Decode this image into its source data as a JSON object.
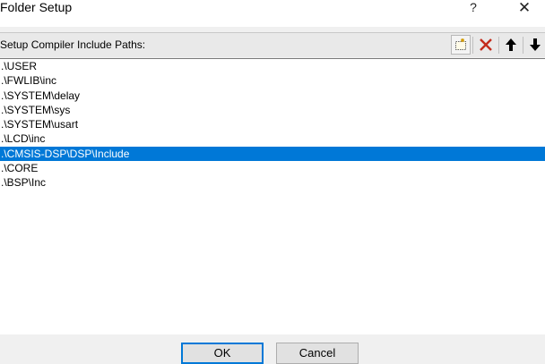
{
  "window": {
    "title": "Folder Setup",
    "help_glyph": "?",
    "close_glyph": "✕"
  },
  "panel": {
    "label": "Setup Compiler Include Paths:"
  },
  "toolbar": {
    "icons": [
      "new-folder-icon",
      "delete-icon",
      "move-up-icon",
      "move-down-icon"
    ],
    "delete_color": "#c42b1c"
  },
  "paths": [
    ".\\USER",
    ".\\FWLIB\\inc",
    ".\\SYSTEM\\delay",
    ".\\SYSTEM\\sys",
    ".\\SYSTEM\\usart",
    ".\\LCD\\inc",
    ".\\CMSIS-DSP\\DSP\\Include",
    ".\\CORE",
    ".\\BSP\\Inc"
  ],
  "selected_index": 6,
  "selection_color": "#0078d7",
  "buttons": {
    "ok": "OK",
    "cancel": "Cancel"
  }
}
